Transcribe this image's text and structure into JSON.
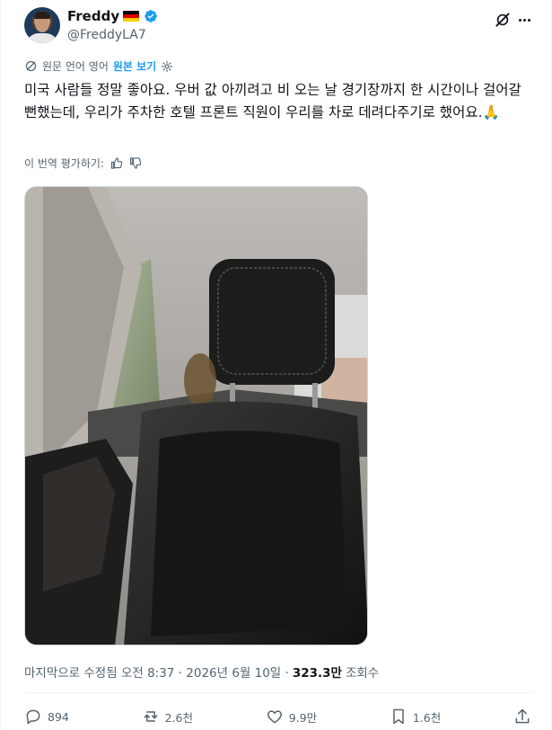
{
  "author": {
    "name": "Freddy",
    "handle": "@FreddyLA7",
    "flag": "german-flag",
    "verified": true
  },
  "translation": {
    "source_label": "원문 언어 영어",
    "show_original": "원본 보기"
  },
  "tweet": {
    "text": "미국 사람들 정말 좋아요. 우버 값 아끼려고 비 오는 날 경기장까지 한 시간이나 걸어갈 뻔했는데, 우리가 주차한 호텔 프론트 직원이 우리를 차로 데려다주기로 했어요.🙏",
    "rate_translation": "이 번역 평가하기:"
  },
  "meta": {
    "edited": "마지막으로 수정됨 오전 8:37 · 2026년 6월 10일 ·",
    "views_count": "323.3만",
    "views_label": "조회수"
  },
  "actions": {
    "replies": "894",
    "reposts": "2.6천",
    "likes": "9.9만",
    "bookmarks": "1.6천"
  },
  "colors": {
    "accent": "#1d9bf0",
    "secondary_text": "#536471",
    "primary_text": "#0f1419"
  }
}
